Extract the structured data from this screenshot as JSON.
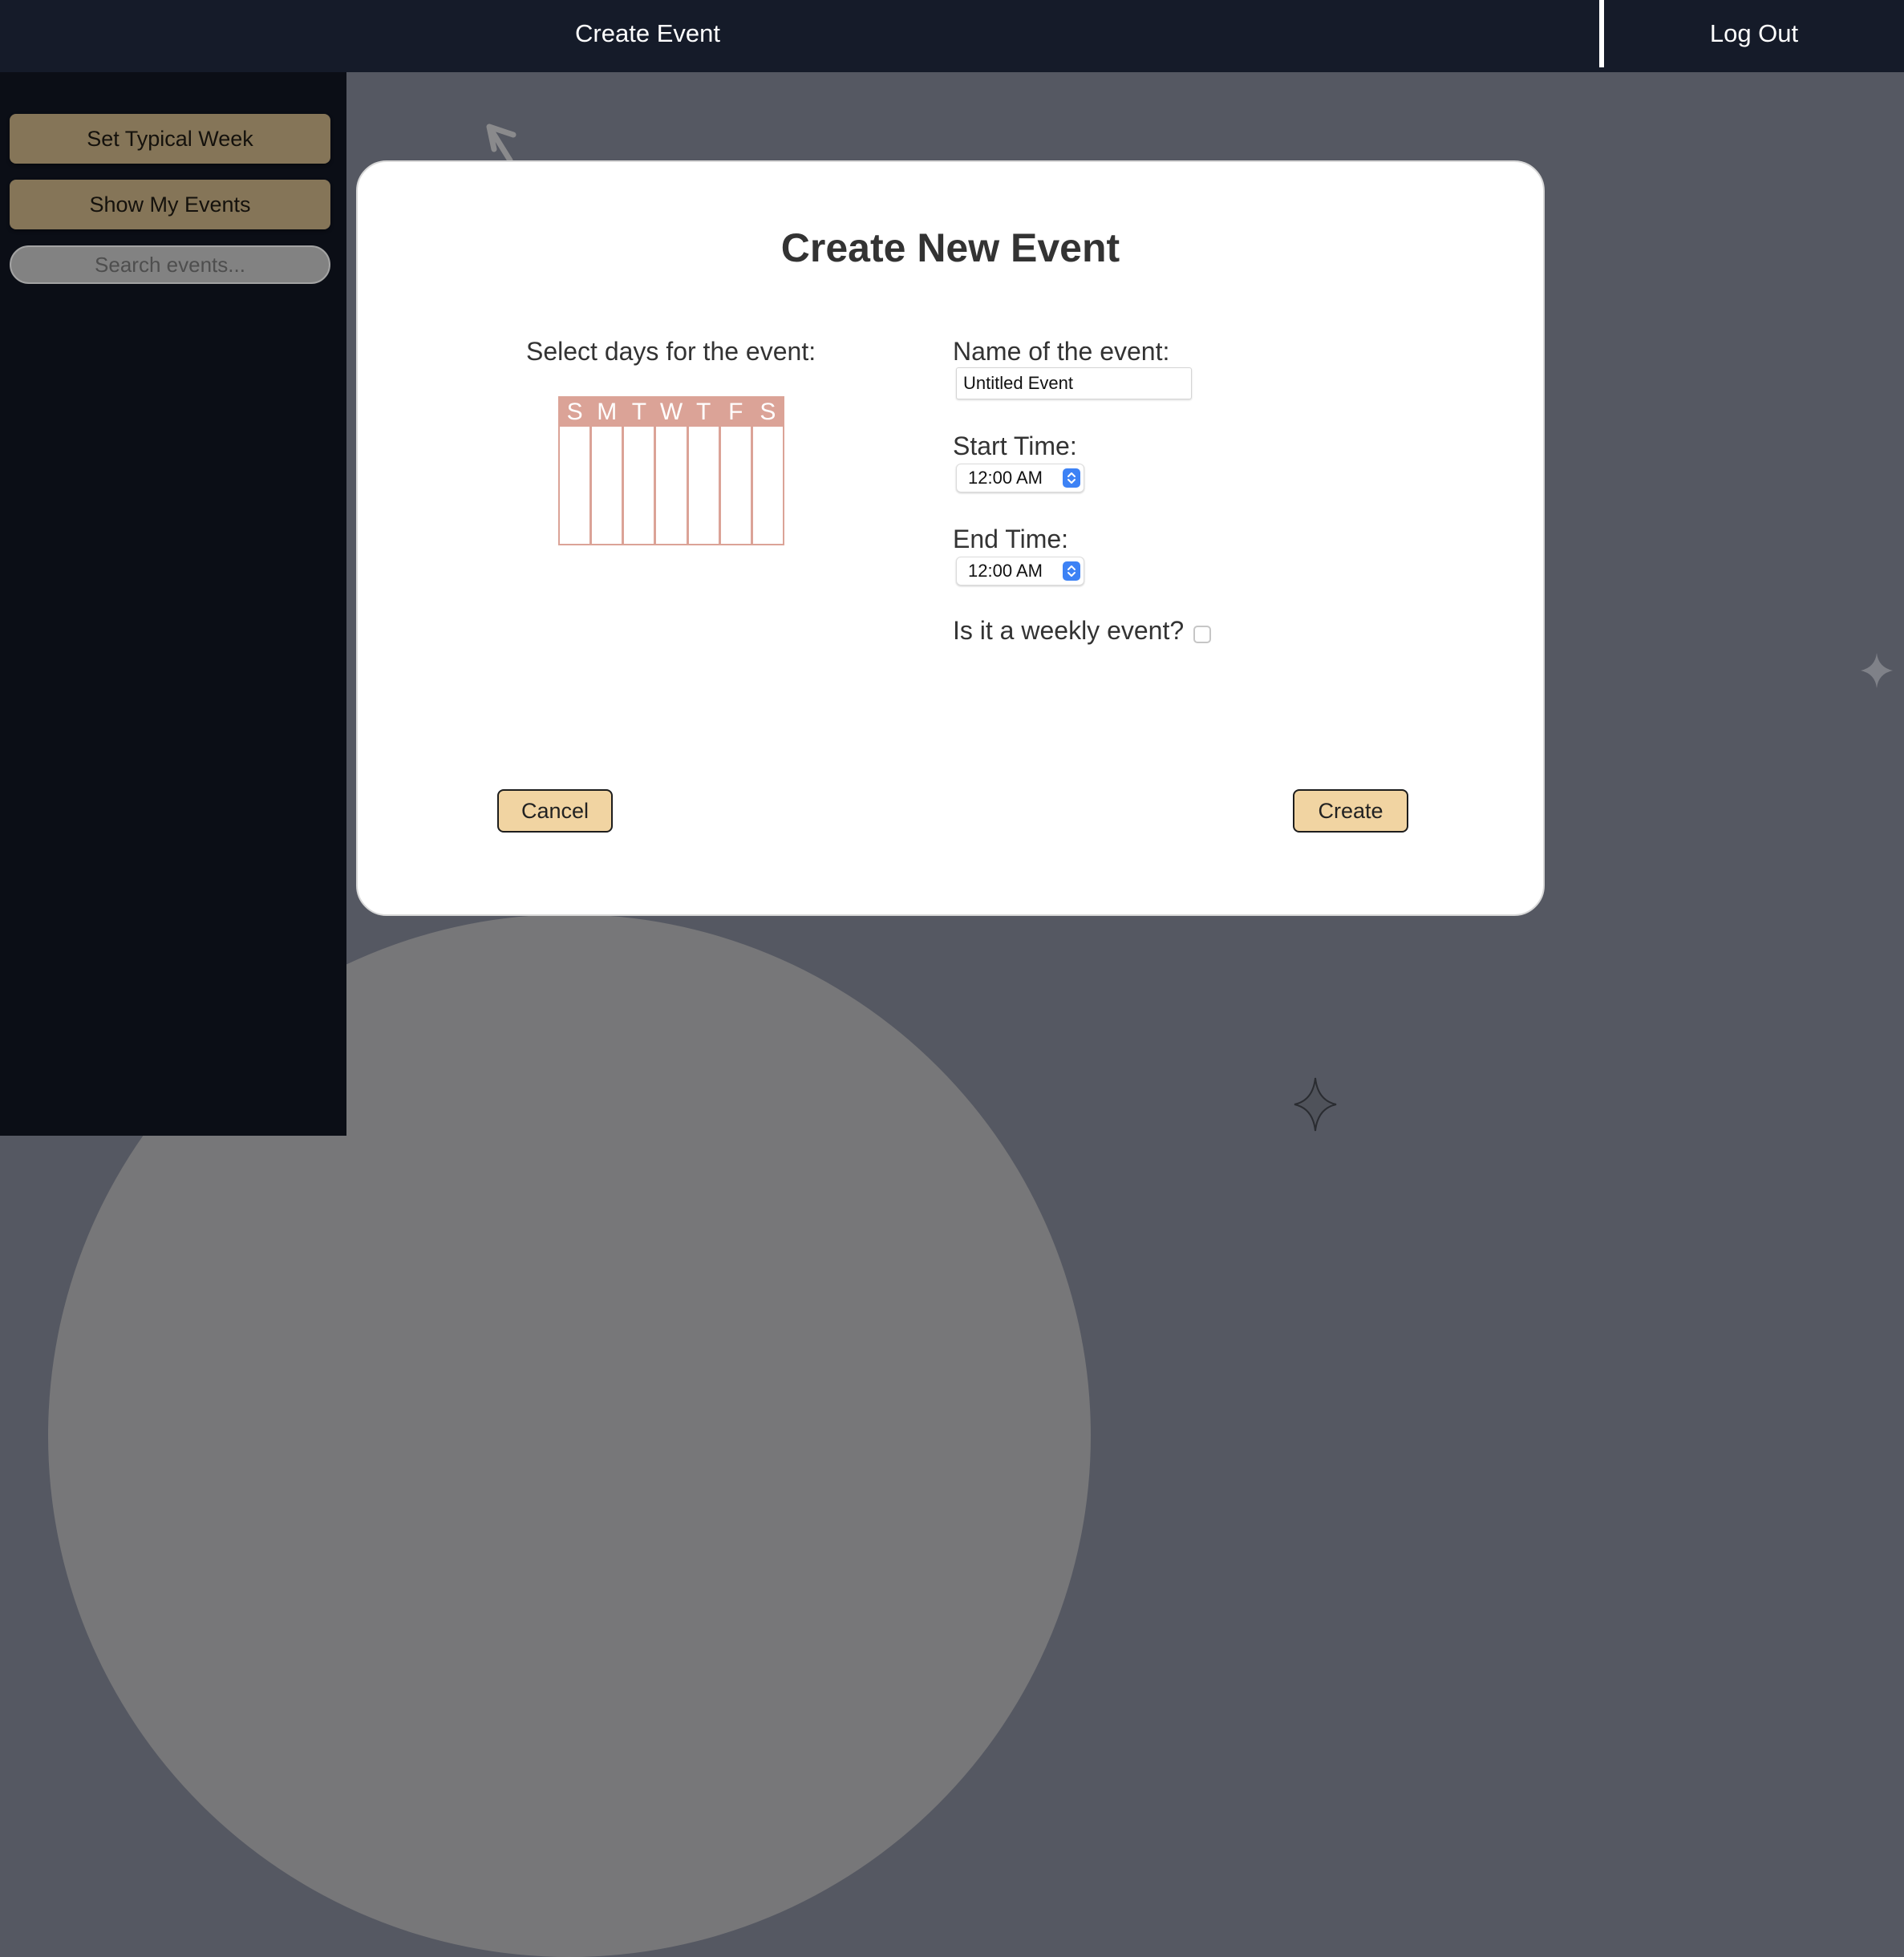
{
  "header": {
    "title": "Create Event",
    "logout_label": "Log Out"
  },
  "sidebar": {
    "set_typical_week_label": "Set Typical Week",
    "show_my_events_label": "Show My Events",
    "search_placeholder": "Search events..."
  },
  "modal": {
    "title": "Create New Event",
    "days_label": "Select days for the event:",
    "days": [
      "S",
      "M",
      "T",
      "W",
      "T",
      "F",
      "S"
    ],
    "name_label": "Name of the event:",
    "name_value": "Untitled Event",
    "start_label": "Start Time:",
    "start_value": "12:00 AM",
    "end_label": "End Time:",
    "end_value": "12:00 AM",
    "weekly_label": "Is it a weekly event?",
    "weekly_checked": false,
    "cancel_label": "Cancel",
    "create_label": "Create"
  },
  "colors": {
    "topbar": "#151b29",
    "sidebar": "#0b0e16",
    "sidebar_button": "#857558",
    "day_grid": "#dba397",
    "modal_button": "#f1d4a2",
    "stepper": "#3d82f5"
  }
}
